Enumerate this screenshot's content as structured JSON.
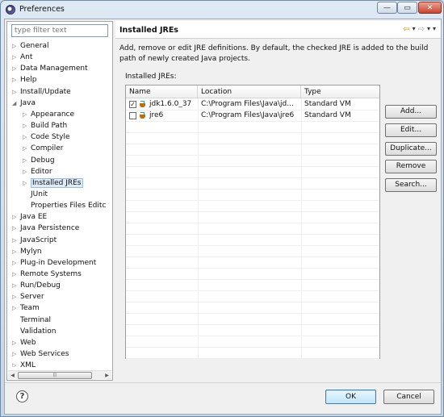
{
  "window": {
    "title": "Preferences",
    "controls": {
      "minimize": "—",
      "maximize": "▭",
      "close": "✕"
    }
  },
  "filter": {
    "placeholder": "type filter text"
  },
  "tree": [
    {
      "label": "General",
      "arrow": "▷",
      "indent": 0
    },
    {
      "label": "Ant",
      "arrow": "▷",
      "indent": 0
    },
    {
      "label": "Data Management",
      "arrow": "▷",
      "indent": 0
    },
    {
      "label": "Help",
      "arrow": "▷",
      "indent": 0
    },
    {
      "label": "Install/Update",
      "arrow": "▷",
      "indent": 0
    },
    {
      "label": "Java",
      "arrow": "◢",
      "indent": 0
    },
    {
      "label": "Appearance",
      "arrow": "▷",
      "indent": 1
    },
    {
      "label": "Build Path",
      "arrow": "▷",
      "indent": 1
    },
    {
      "label": "Code Style",
      "arrow": "▷",
      "indent": 1
    },
    {
      "label": "Compiler",
      "arrow": "▷",
      "indent": 1
    },
    {
      "label": "Debug",
      "arrow": "▷",
      "indent": 1
    },
    {
      "label": "Editor",
      "arrow": "▷",
      "indent": 1
    },
    {
      "label": "Installed JREs",
      "arrow": "▷",
      "indent": 1,
      "selected": true
    },
    {
      "label": "JUnit",
      "arrow": "",
      "indent": 1
    },
    {
      "label": "Properties Files Editc",
      "arrow": "",
      "indent": 1
    },
    {
      "label": "Java EE",
      "arrow": "▷",
      "indent": 0
    },
    {
      "label": "Java Persistence",
      "arrow": "▷",
      "indent": 0
    },
    {
      "label": "JavaScript",
      "arrow": "▷",
      "indent": 0
    },
    {
      "label": "Mylyn",
      "arrow": "▷",
      "indent": 0
    },
    {
      "label": "Plug-in Development",
      "arrow": "▷",
      "indent": 0
    },
    {
      "label": "Remote Systems",
      "arrow": "▷",
      "indent": 0
    },
    {
      "label": "Run/Debug",
      "arrow": "▷",
      "indent": 0
    },
    {
      "label": "Server",
      "arrow": "▷",
      "indent": 0
    },
    {
      "label": "Team",
      "arrow": "▷",
      "indent": 0
    },
    {
      "label": "Terminal",
      "arrow": "",
      "indent": 0
    },
    {
      "label": "Validation",
      "arrow": "",
      "indent": 0
    },
    {
      "label": "Web",
      "arrow": "▷",
      "indent": 0
    },
    {
      "label": "Web Services",
      "arrow": "▷",
      "indent": 0
    },
    {
      "label": "XML",
      "arrow": "▷",
      "indent": 0
    }
  ],
  "page": {
    "title": "Installed JREs",
    "description": "Add, remove or edit JRE definitions. By default, the checked JRE is added to the build path of newly created Java projects.",
    "section_label": "Installed JREs:"
  },
  "table": {
    "columns": [
      "Name",
      "Location",
      "Type"
    ],
    "rows": [
      {
        "checked": true,
        "name": "jdk1.6.0_37",
        "location": "C:\\Program Files\\Java\\jd...",
        "type": "Standard VM"
      },
      {
        "checked": false,
        "name": "jre6",
        "location": "C:\\Program Files\\Java\\jre6",
        "type": "Standard VM"
      }
    ]
  },
  "buttons": {
    "add": "Add...",
    "edit": "Edit...",
    "duplicate": "Duplicate...",
    "remove": "Remove",
    "search": "Search...",
    "ok": "OK",
    "cancel": "Cancel",
    "help": "?"
  }
}
